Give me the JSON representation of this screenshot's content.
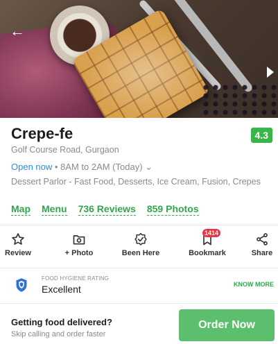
{
  "restaurant": {
    "name": "Crepe-fe",
    "rating": "4.3",
    "address": "Golf Course Road, Gurgaon",
    "open_status": "Open now",
    "hours": " • 8AM to 2AM (Today) ",
    "hours_chevron": "⌄",
    "cuisines": "Dessert Parlor - Fast Food, Desserts, Ice Cream, Fusion, Crepes"
  },
  "links": {
    "map": "Map",
    "menu": "Menu",
    "reviews": "736 Reviews",
    "photos": "859 Photos"
  },
  "actions": {
    "review": "Review",
    "add_photo": "+ Photo",
    "been_here": "Been Here",
    "bookmark": "Bookmark",
    "bookmark_count": "1414",
    "share": "Share"
  },
  "hygiene": {
    "label": "FOOD HYGIENE RATING",
    "value": "Excellent",
    "know_more": "KNOW MORE"
  },
  "delivery": {
    "title": "Getting food delivered?",
    "subtitle": "Skip calling and order faster",
    "button": "Order Now"
  },
  "colors": {
    "accent_green": "#3ab54a",
    "link_blue": "#2d8ee0",
    "badge_red": "#e23744",
    "order_button": "#5cbf6e"
  },
  "icons": {
    "back": "back-arrow-icon",
    "next": "next-arrow-icon",
    "review": "star-outline-icon",
    "photo": "camera-folder-icon",
    "been_here": "check-badge-icon",
    "bookmark": "bookmark-icon",
    "share": "share-icon",
    "hygiene": "shield-icon"
  }
}
